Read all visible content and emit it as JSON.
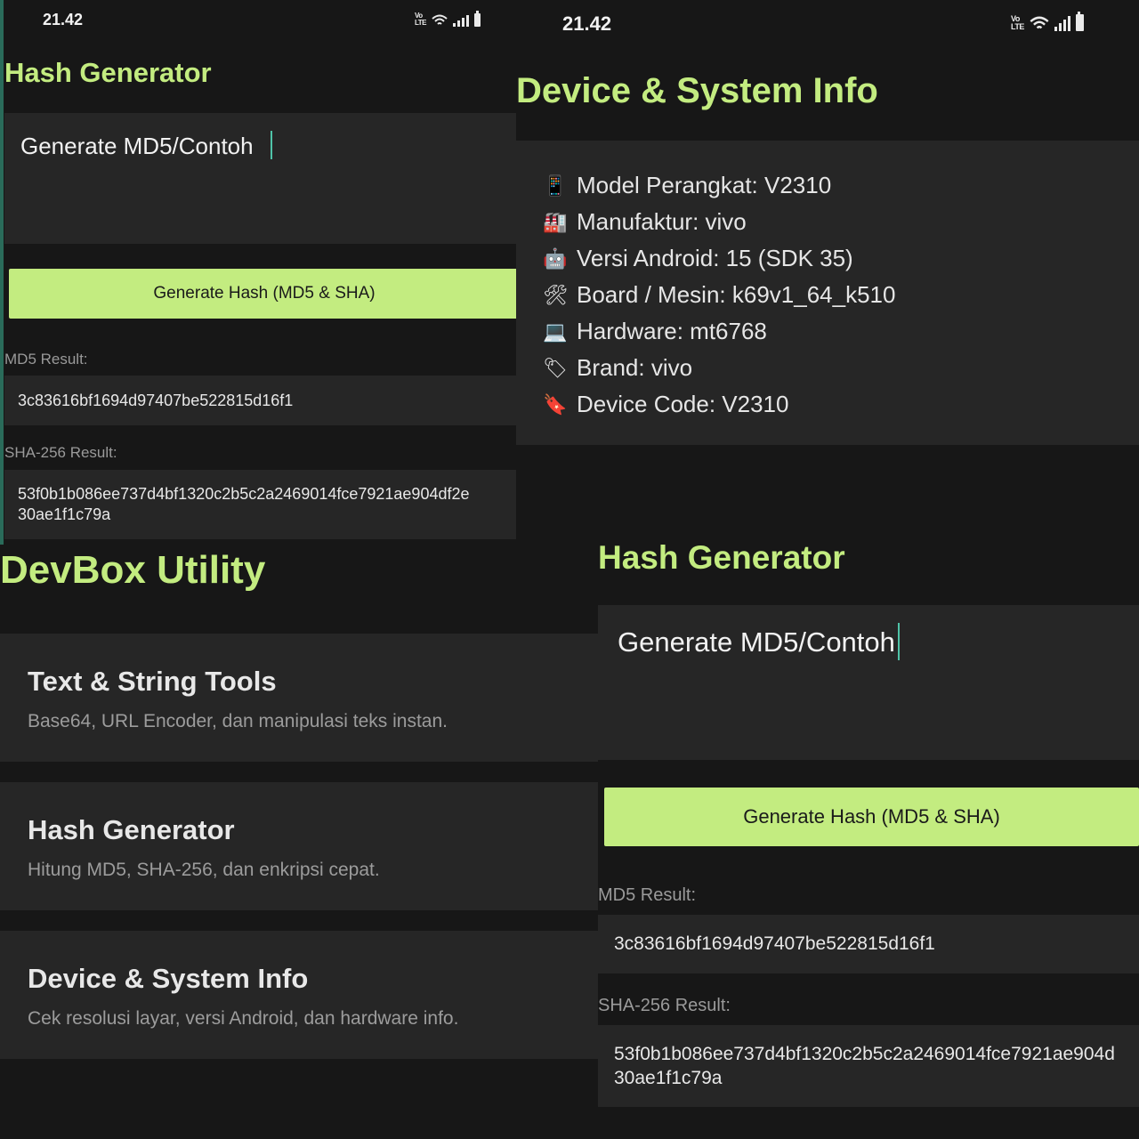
{
  "status": {
    "time": "21.42",
    "volte": "Vo LTE"
  },
  "screen_a": {
    "title": "Hash Generator",
    "input_value": "Generate MD5/Contoh",
    "button_label": "Generate Hash (MD5 & SHA)",
    "md5_label": "MD5 Result:",
    "md5_value": "3c83616bf1694d97407be522815d16f1",
    "sha_label": "SHA-256 Result:",
    "sha_value_line1": "53f0b1b086ee737d4bf1320c2b5c2a2469014fce7921ae904df2e",
    "sha_value_line2": "30ae1f1c79a"
  },
  "screen_b": {
    "title": "Device & System Info",
    "items": [
      {
        "icon": "mobile-phone-icon",
        "text": "Model Perangkat: V2310"
      },
      {
        "icon": "factory-icon",
        "text": "Manufaktur: vivo"
      },
      {
        "icon": "robot-icon",
        "text": "Versi Android: 15 (SDK 35)"
      },
      {
        "icon": "tools-icon",
        "text": "Board / Mesin: k69v1_64_k510"
      },
      {
        "icon": "laptop-icon",
        "text": "Hardware: mt6768"
      },
      {
        "icon": "tag-icon",
        "text": "Brand: vivo"
      },
      {
        "icon": "bookmark-icon",
        "text": "Device Code: V2310"
      }
    ]
  },
  "screen_c": {
    "title": "DevBox Utility",
    "tools": [
      {
        "title": "Text & String Tools",
        "desc": "Base64, URL Encoder, dan manipulasi teks instan."
      },
      {
        "title": "Hash Generator",
        "desc": "Hitung MD5, SHA-256, dan enkripsi cepat."
      },
      {
        "title": "Device & System Info",
        "desc": "Cek resolusi layar, versi Android, dan hardware info."
      }
    ]
  },
  "screen_d": {
    "title": "Hash Generator",
    "input_value": "Generate MD5/Contoh",
    "button_label": "Generate Hash (MD5 & SHA)",
    "md5_label": "MD5 Result:",
    "md5_value": "3c83616bf1694d97407be522815d16f1",
    "sha_label": "SHA-256 Result:",
    "sha_value_line1": "53f0b1b086ee737d4bf1320c2b5c2a2469014fce7921ae904d",
    "sha_value_line2": "30ae1f1c79a"
  },
  "colors": {
    "accent": "#c3ec80",
    "background": "#1a1a1a",
    "card": "#262626",
    "caret": "#4fc3a8"
  }
}
